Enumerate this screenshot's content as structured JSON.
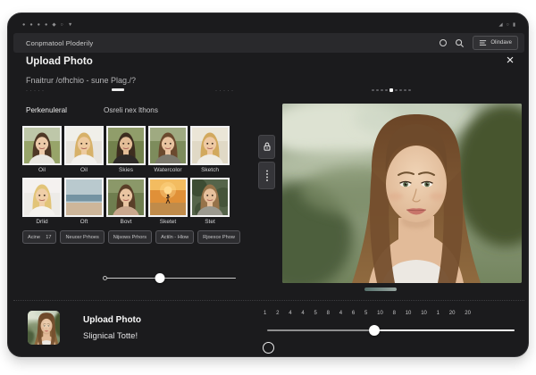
{
  "status_bar": {
    "left_glyphs": [
      "●",
      "●",
      "●",
      "●",
      "◆",
      "○",
      "▼"
    ],
    "right_glyphs": [
      "◢",
      "○",
      "▮"
    ]
  },
  "app_bar": {
    "title": "Conpmatool Ploderily",
    "overflow_label": "Olindave"
  },
  "modal": {
    "title": "Upload Photo",
    "subtitle": "Fnaitrur /ofhchio - sune Plag./?",
    "close_glyph": "×"
  },
  "decor": {
    "dots_left": "·····",
    "dots_right": "·····"
  },
  "tabs": [
    {
      "label": "Perkenuleral"
    },
    {
      "label": "Osreli nex lthons"
    }
  ],
  "style_rows": {
    "row1": [
      {
        "label": "Oil",
        "type": "portrait",
        "bg": "#97a469",
        "bg_top": "#c2cbb0",
        "hair": "#4e3826",
        "skin": "#eccaa9",
        "top": "#e9e7e1"
      },
      {
        "label": "Oil",
        "type": "portrait",
        "bg": "#e7e4de",
        "bg_top": "#f1efea",
        "hair": "#d7b169",
        "skin": "#edca9f",
        "top": "#f2f0ec"
      },
      {
        "label": "Skies",
        "type": "portrait",
        "bg": "#72814c",
        "bg_top": "#93a06e",
        "hair": "#3d2d1f",
        "skin": "#e3bd97",
        "top": "#2e2a28"
      },
      {
        "label": "Watercolor",
        "type": "portrait",
        "bg": "#7d8c5c",
        "bg_top": "#a3ad85",
        "hair": "#6b4a2e",
        "skin": "#e8c3a0",
        "top": "#7d7a6e"
      },
      {
        "label": "Sketch",
        "type": "portrait",
        "bg": "#e0d9c6",
        "bg_top": "#ece7d8",
        "hair": "#d2a95e",
        "skin": "#eec9a4",
        "top": "#efece4"
      }
    ],
    "row2": [
      {
        "label": "Drlid",
        "type": "portrait",
        "bg": "#edebe7",
        "bg_top": "#f4f2ef",
        "hair": "#e2c478",
        "skin": "#f0cfa8",
        "top": "#f5f3ef"
      },
      {
        "label": "Oft",
        "type": "beach",
        "sky": "#b9c9ce",
        "sea": "#7493a2",
        "sand": "#cdb69a"
      },
      {
        "label": "Bovt",
        "type": "portrait",
        "bg": "#6f7e4f",
        "bg_top": "#8e9b6c",
        "hair": "#5a3f28",
        "skin": "#e9c5a2",
        "top": "#caa88e"
      },
      {
        "label": "Sketet",
        "type": "sunset",
        "sky": "#f3bc60",
        "glow": "#ffd98e",
        "sand": "#c08b4a",
        "figure": "#3a2415"
      },
      {
        "label": "Stet",
        "type": "forest",
        "bg": "#55644a",
        "hair": "#97734a",
        "skin": "#e6c09c",
        "top": "#9b998f"
      }
    ]
  },
  "filter_chips": [
    {
      "label": "Acine    17"
    },
    {
      "label": "Neuosr Prhoes"
    },
    {
      "label": "Nijsows Prhors"
    },
    {
      "label": "Actiln - Hlow"
    },
    {
      "label": "Rjoexce Phow"
    }
  ],
  "sliders": {
    "style": {
      "pct": 42.5
    },
    "count": {
      "pct": 43.3
    }
  },
  "pager": {
    "count": 9,
    "active": 4
  },
  "bottom": {
    "title": "Upload Photo",
    "subtitle": "Slignical Totte!"
  },
  "count_scale": [
    "1",
    "2",
    "4",
    "4",
    "5",
    "8",
    "4",
    "6",
    "5",
    "10",
    "8",
    "10",
    "10",
    "1",
    "20",
    "20"
  ],
  "portrait_palette": {
    "hair": "#6b4527",
    "hair_light": "#8f6a3f",
    "skin": "#f0d4b6",
    "eyes": "#5d7050",
    "background_sage": "#9aa98f",
    "tree_green": "#46542f"
  }
}
